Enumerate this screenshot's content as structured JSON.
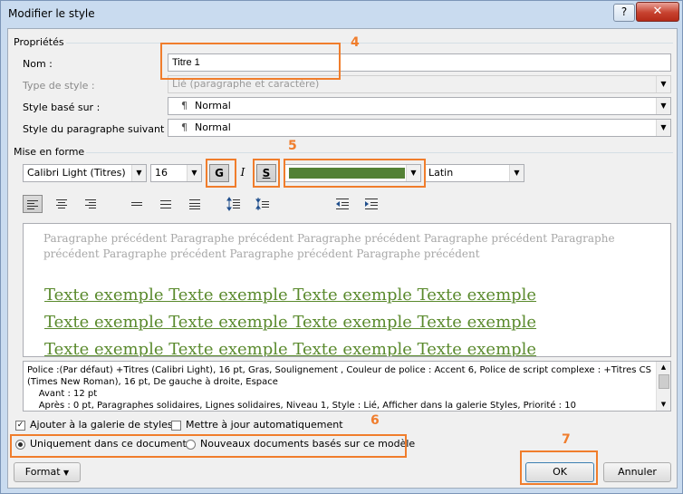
{
  "window": {
    "title": "Modifier le style",
    "help_label": "?",
    "close_label": "✕"
  },
  "properties": {
    "section_label": "Propriétés",
    "name_label": "Nom :",
    "name_value": "Titre 1",
    "type_label": "Type de style :",
    "type_value": "Lié (paragraphe et caractère)",
    "based_label": "Style basé sur :",
    "based_value": "Normal",
    "next_label": "Style du paragraphe suivant :",
    "next_value": "Normal",
    "pilcrow": "¶"
  },
  "format": {
    "section_label": "Mise en forme",
    "font": "Calibri Light (Titres)",
    "size": "16",
    "bold_label": "G",
    "italic_label": "I",
    "underline_label": "S",
    "font_color": "#538135",
    "script": "Latin"
  },
  "preview": {
    "previous_paragraph": "Paragraphe précédent Paragraphe précédent Paragraphe précédent Paragraphe précédent Paragraphe précédent Paragraphe précédent Paragraphe précédent Paragraphe précédent",
    "sample_lines": [
      "Texte exemple Texte exemple Texte exemple Texte exemple",
      "Texte exemple Texte exemple Texte exemple Texte exemple",
      "Texte exemple Texte exemple Texte exemple Texte exemple"
    ]
  },
  "description": {
    "lines": [
      "Police :(Par défaut) +Titres (Calibri Light), 16 pt, Gras, Soulignement , Couleur de police : Accent 6, Police de script complexe : +Titres CS",
      "(Times New Roman), 16 pt, De gauche à droite, Espace",
      "    Avant : 12 pt",
      "    Après : 0 pt, Paragraphes solidaires, Lignes solidaires, Niveau 1, Style : Lié, Afficher dans la galerie Styles, Priorité : 10"
    ]
  },
  "options": {
    "add_gallery_label": "Ajouter à la galerie de styles",
    "add_gallery_checked": true,
    "auto_update_label": "Mettre à jour automatiquement",
    "auto_update_checked": false,
    "only_doc_label": "Uniquement dans ce document",
    "new_docs_label": "Nouveaux documents basés sur ce modèle",
    "selected_scope": "only_doc"
  },
  "buttons": {
    "format_label": "Format",
    "ok_label": "OK",
    "cancel_label": "Annuler"
  },
  "callouts": {
    "c4": "4",
    "c5": "5",
    "c6": "6",
    "c7": "7"
  },
  "colors": {
    "callout": "#f07d2c",
    "sample_text": "#5a8a2d",
    "close_button": "#c7422f"
  }
}
